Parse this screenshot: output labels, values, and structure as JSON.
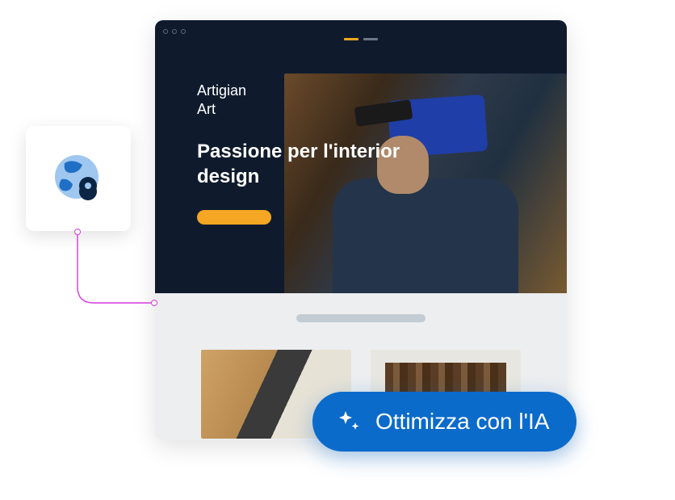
{
  "hero": {
    "brand": "Artigian\nArt",
    "headline": "Passione per l'interior design"
  },
  "ai_button": {
    "label": "Ottimizza con l'IA"
  },
  "icons": {
    "globe": "globe-location-icon",
    "sparkle": "sparkle-icon"
  },
  "colors": {
    "accent_orange": "#f5a623",
    "ai_blue": "#0b6bcb",
    "connector_pink": "#d63adf"
  }
}
